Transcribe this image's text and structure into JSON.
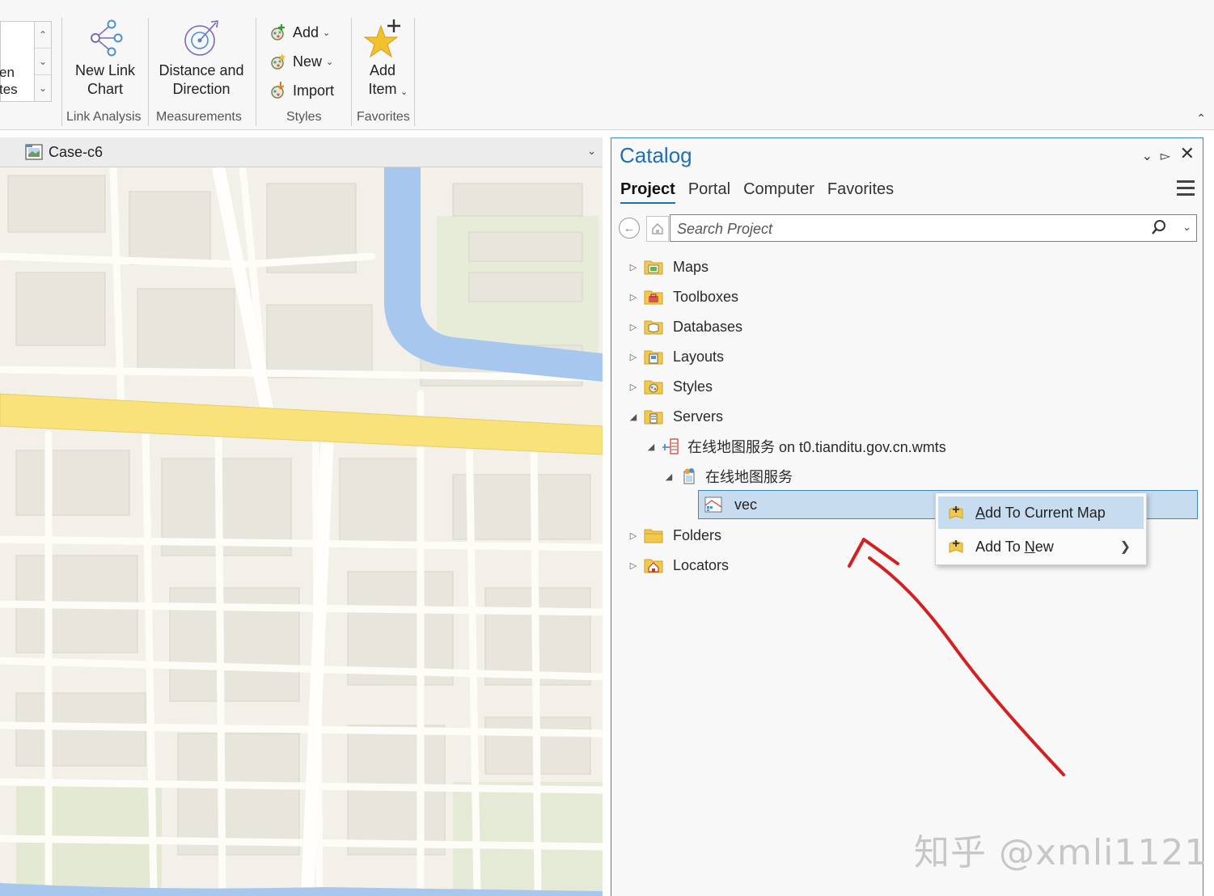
{
  "ribbon": {
    "gallery_text": "en\ntes",
    "link_analysis": {
      "new_link_chart": "New Link\nChart",
      "group_label": "Link Analysis"
    },
    "measurements": {
      "distance_direction": "Distance and\nDirection",
      "group_label": "Measurements"
    },
    "styles": {
      "add": "Add",
      "new": "New",
      "import": "Import",
      "group_label": "Styles"
    },
    "favorites": {
      "add_item": "Add\nItem",
      "group_label": "Favorites"
    }
  },
  "map_view": {
    "tab_title": "Case-c6"
  },
  "catalog": {
    "title": "Catalog",
    "tabs": [
      {
        "label": "Project",
        "active": true
      },
      {
        "label": "Portal",
        "active": false
      },
      {
        "label": "Computer",
        "active": false
      },
      {
        "label": "Favorites",
        "active": false
      }
    ],
    "search_placeholder": "Search Project",
    "tree": {
      "maps": "Maps",
      "toolboxes": "Toolboxes",
      "databases": "Databases",
      "layouts": "Layouts",
      "styles": "Styles",
      "servers": "Servers",
      "server_connection": "在线地图服务 on t0.tianditu.gov.cn.wmts",
      "service": "在线地图服务",
      "layer": "vec",
      "folders": "Folders",
      "locators": "Locators"
    }
  },
  "context_menu": {
    "items": [
      {
        "pre": "",
        "key": "A",
        "post": "dd To Current Map",
        "highlighted": true
      },
      {
        "pre": "Add To ",
        "key": "N",
        "post": "ew",
        "submenu": true
      }
    ]
  },
  "watermark": "知乎 @xmli1121",
  "colors": {
    "accent": "#1f6fb3",
    "selection": "#c7dcef",
    "annotation": "#d42020",
    "highway": "#f9e27a",
    "water": "#a7c7ee"
  }
}
